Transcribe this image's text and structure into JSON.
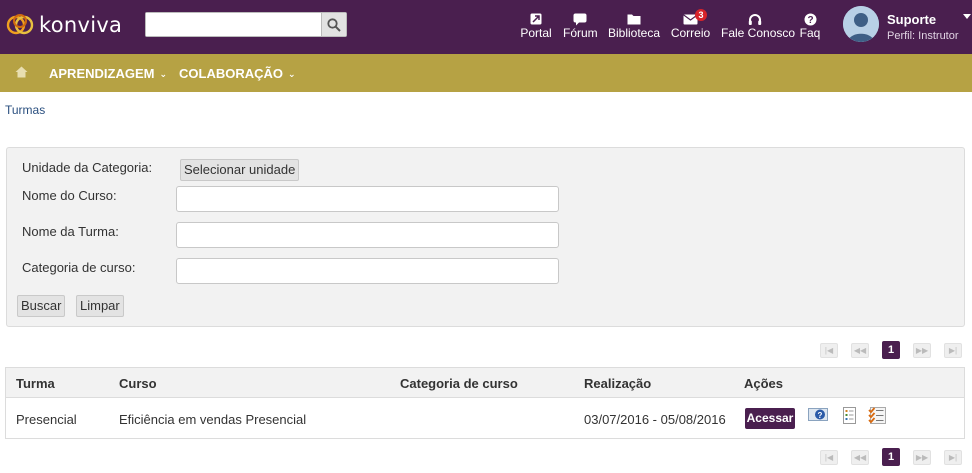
{
  "app": {
    "logo_text": "konviva",
    "search_placeholder": ""
  },
  "top_nav": [
    {
      "label": "Portal",
      "icon": "portal-icon"
    },
    {
      "label": "Fórum",
      "icon": "forum-icon"
    },
    {
      "label": "Biblioteca",
      "icon": "folder-icon"
    },
    {
      "label": "Correio",
      "icon": "mail-icon",
      "badge": "3"
    },
    {
      "label": "Fale Conosco",
      "icon": "headset-icon"
    },
    {
      "label": "Faq",
      "icon": "help-icon"
    }
  ],
  "user": {
    "name": "Suporte",
    "profile": "Perfil: Instrutor"
  },
  "menu": {
    "items": [
      {
        "label": "APRENDIZAGEM"
      },
      {
        "label": "COLABORAÇÃO"
      }
    ]
  },
  "breadcrumb": "Turmas",
  "filter": {
    "unit_label": "Unidade da Categoria:",
    "unit_button": "Selecionar unidade",
    "course_label": "Nome do Curso:",
    "course_value": "",
    "class_label": "Nome da Turma:",
    "class_value": "",
    "category_label": "Categoria de curso:",
    "category_value": "",
    "search_button": "Buscar",
    "clear_button": "Limpar"
  },
  "pagination": {
    "first": "|◀",
    "prev": "◀◀",
    "current": "1",
    "next": "▶▶",
    "last": "▶|"
  },
  "table": {
    "headers": [
      "Turma",
      "Curso",
      "Categoria de curso",
      "Realização",
      "Ações"
    ],
    "rows": [
      {
        "turma": "Presencial",
        "curso": "Eficiência em vendas Presencial",
        "categoria": "",
        "realizacao": "03/07/2016 - 05/08/2016",
        "acessar": "Acessar"
      }
    ]
  },
  "colors": {
    "header_bg": "#4a1f4f",
    "menubar_bg": "#b6a244",
    "link": "#2a4f7f",
    "badge": "#d8232a"
  }
}
